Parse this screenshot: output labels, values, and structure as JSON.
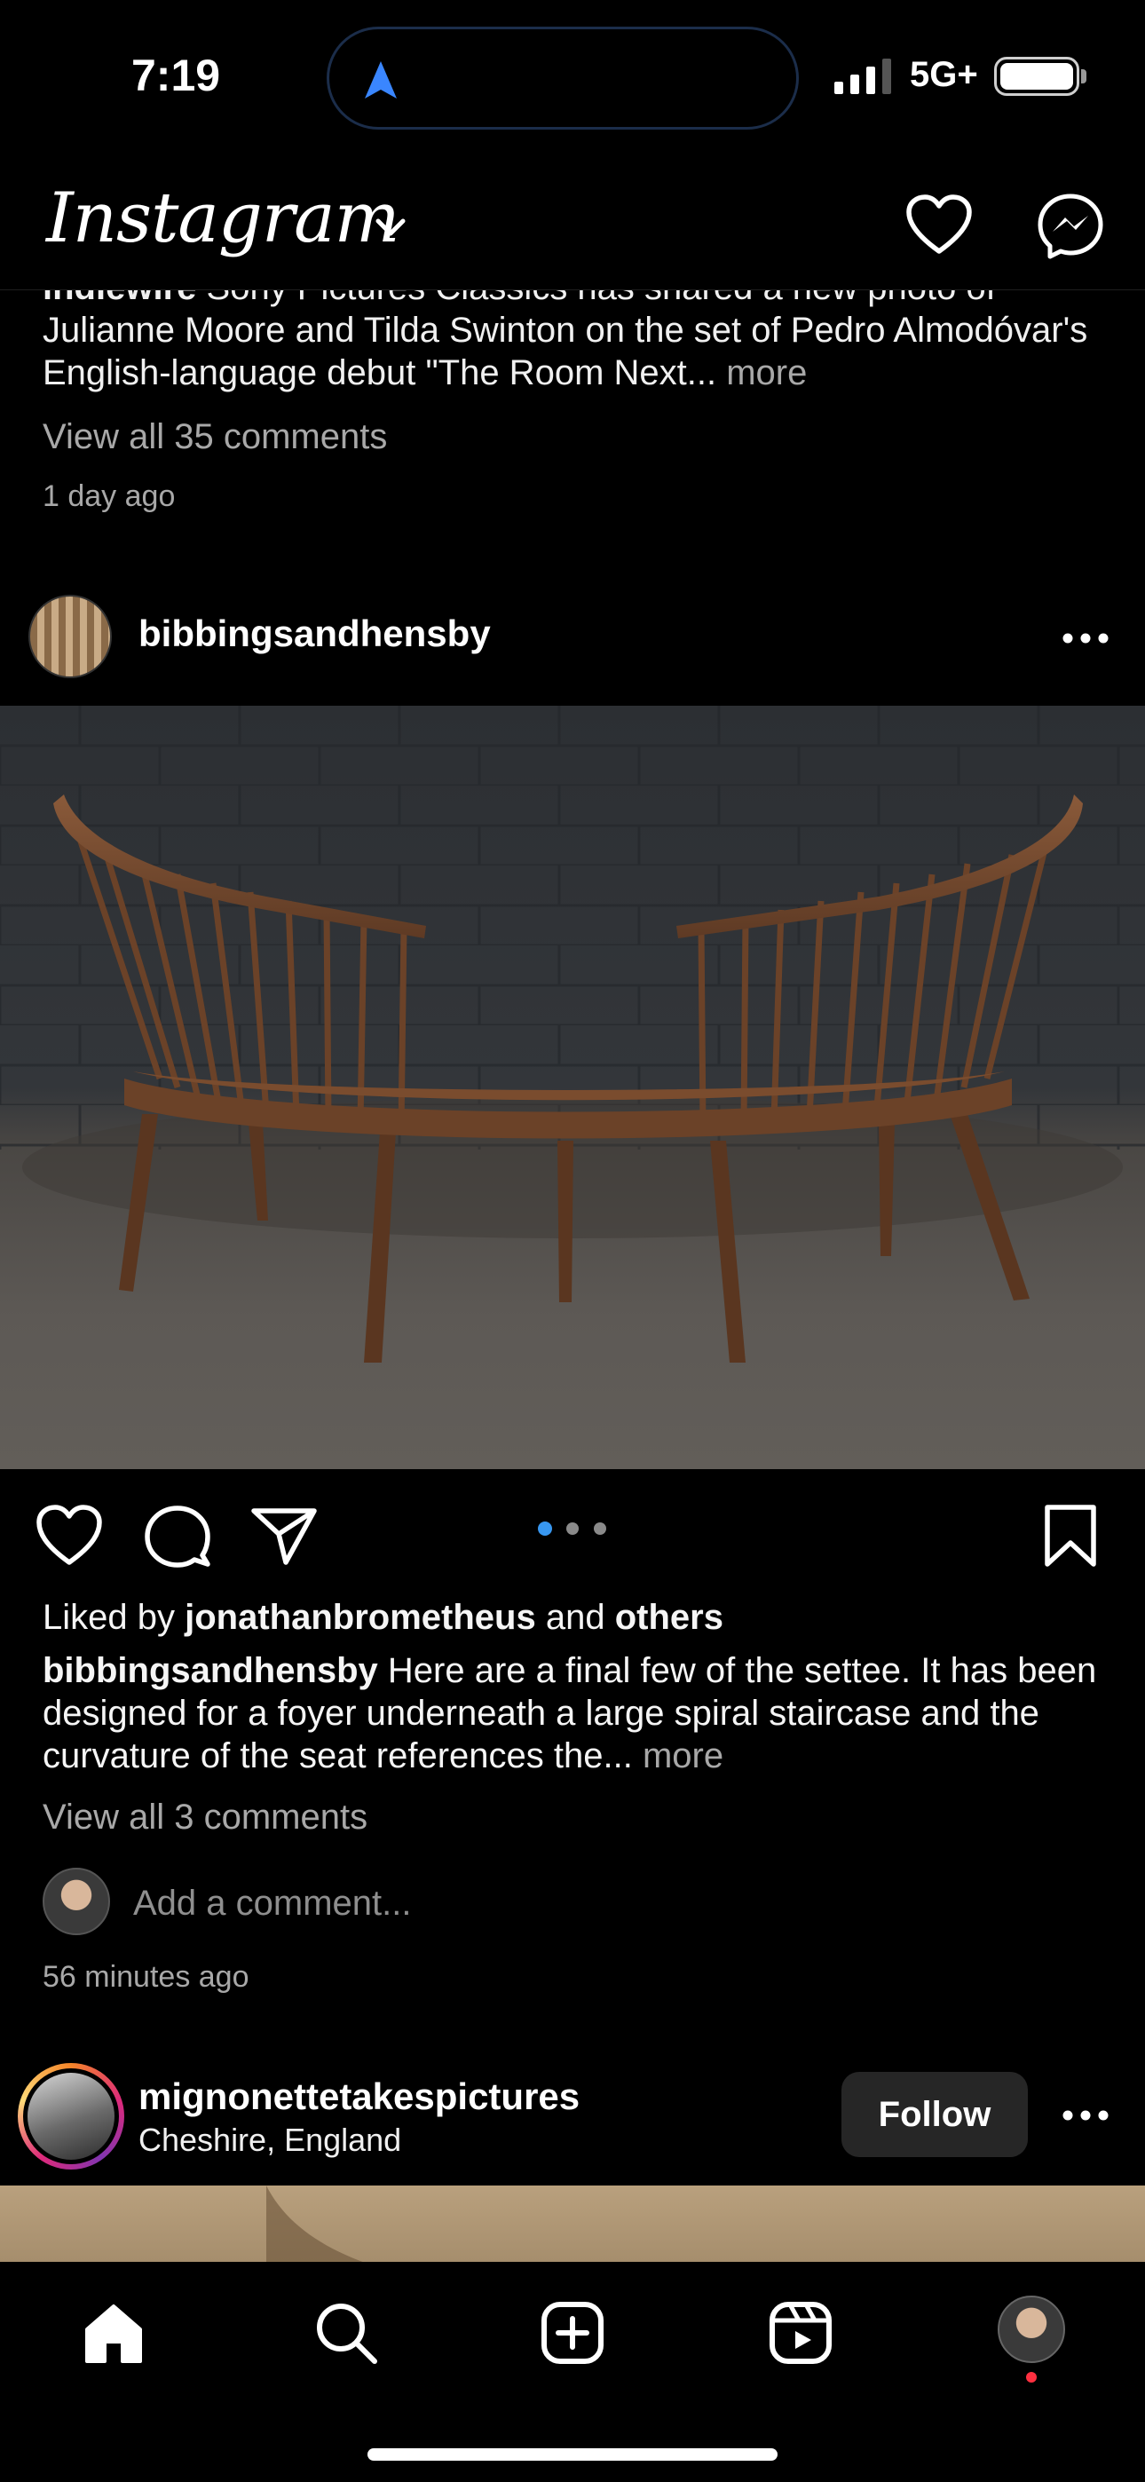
{
  "status_bar": {
    "time": "7:19",
    "network": "5G+"
  },
  "header": {
    "logo": "Instagram"
  },
  "previous_post": {
    "caption_user": "indiewire",
    "caption_text": "Sony Pictures Classics has shared a new photo of Julianne Moore and Tilda Swinton on the set of Pedro Almodóvar's English-language debut \"The Room Next...",
    "more_label": "more",
    "view_comments": "View all 35 comments",
    "time": "1 day ago"
  },
  "post": {
    "username": "bibbingsandhensby",
    "liked_prefix": "Liked by",
    "liked_user": "jonathanbrometheus",
    "liked_and": "and",
    "liked_others": "others",
    "caption_user": "bibbingsandhensby",
    "caption_text": "Here are a final few of the settee. It has been designed for a foyer underneath a large spiral staircase and the curvature of the seat references the...",
    "more_label": "more",
    "view_comments": "View all 3 comments",
    "comment_placeholder": "Add a comment...",
    "time": "56 minutes ago",
    "carousel": {
      "count": 3,
      "active": 1
    }
  },
  "next_post": {
    "username": "mignonettetakespictures",
    "location": "Cheshire, England",
    "follow_label": "Follow"
  },
  "colors": {
    "accent_blue": "#3897f0",
    "notification_red": "#ff3040",
    "muted": "#a8a8a8"
  },
  "icons": [
    "nav-arrow-icon",
    "signal-icon",
    "battery-icon",
    "chevron-down-icon",
    "heart-icon",
    "messenger-icon",
    "more-icon",
    "like-icon",
    "comment-icon",
    "share-icon",
    "bookmark-icon",
    "home-icon",
    "search-icon",
    "create-icon",
    "reels-icon"
  ]
}
